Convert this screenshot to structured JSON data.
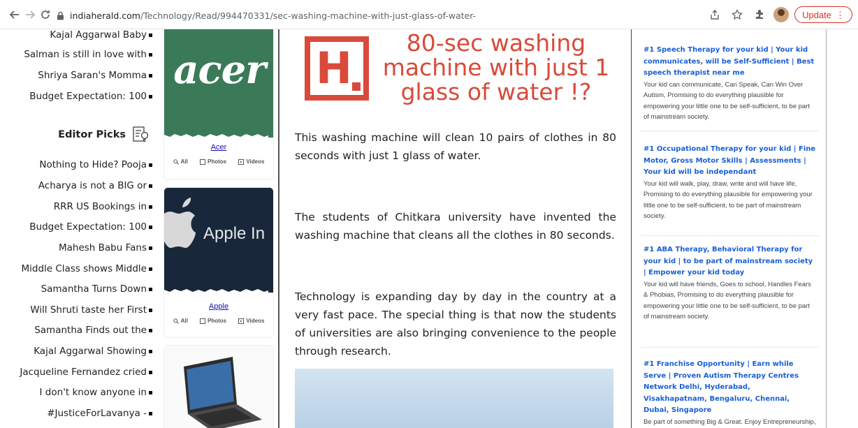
{
  "browser": {
    "url_host": "indiaherald.com",
    "url_path": "/Technology/Read/994470331/sec-washing-machine-with-just-glass-of-water-",
    "update_label": "Update"
  },
  "left_list": {
    "top_items": [
      "Kajal Aggarwal Baby",
      "Salman is still in love with",
      "Shriya Saran's Momma",
      "Budget Expectation: 100"
    ],
    "editor_picks_label": "Editor Picks",
    "picks": [
      "Nothing to Hide? Pooja",
      "Acharya is not a BIG or",
      "RRR US Bookings in",
      "Budget Expectation: 100",
      "Mahesh Babu Fans",
      "Middle Class shows Middle",
      "Samantha Turns Down",
      "Will Shruti taste her First",
      "Samantha Finds out the",
      "Kajal Aggarwal Showing",
      "Jacqueline Fernandez cried",
      "I don't know anyone in",
      "#JusticeForLavanya -"
    ]
  },
  "brands": [
    {
      "logo_text": "acer",
      "name": "Acer",
      "link_all": "All",
      "link_photos": "Photos",
      "link_videos": "Videos"
    },
    {
      "logo_text": "Apple In",
      "name": "Apple",
      "link_all": "All",
      "link_photos": "Photos",
      "link_videos": "Videos"
    }
  ],
  "article": {
    "logo_letter": "H",
    "hero_text": "80-sec washing machine with just 1 glass of water !?",
    "paragraphs": [
      "This washing machine will clean 10 pairs of clothes in 80 seconds with just 1 glass of water.",
      "The students of Chitkara university have invented the washing machine that cleans all the clothes in 80 seconds.",
      "Technology is expanding day by day in the country at a very fast pace. The special thing is that now the students of universities are also bringing convenience to the people through research."
    ]
  },
  "ads": [
    {
      "title": "#1 Speech Therapy for your kid | Your kid communicates, will be Self-Sufficient | Best speech therapist near me",
      "body": "Your kid can communicate, Can Speak, Can Win Over Autism, Promising to do everything plausible for empowering your little one to be self-sufficient, to be part of mainstream society."
    },
    {
      "title": "#1 Occupational Therapy for your kid | Fine Motor, Gross Motor Skills | Assessments | Your kid will be independant",
      "body": "Your kid will walk, play, draw, write and will have life, Promising to do everything plausible for empowering your little one to be self-sufficient, to be part of mainstream society."
    },
    {
      "title": "#1 ABA Therapy, Behavioral Therapy for your kid | to be part of mainstream society | Empower your kid today",
      "body": "Your kid will have friends, Goes to school, Handles Fears & Phobias, Promising to do everything plausible for empowering your little one to be self-sufficient, to be part of mainstream society."
    },
    {
      "title": "#1 Franchise Opportunity | Earn while Serve | Proven Autism Therapy Centres Network Delhi, Hyderabad, Visakhapatnam, Bengaluru, Chennai, Dubai, Singapore",
      "body": "Be part of something Big & Great. Enjoy Entrepreneurship, Earn Money, Be blessed to"
    }
  ]
}
